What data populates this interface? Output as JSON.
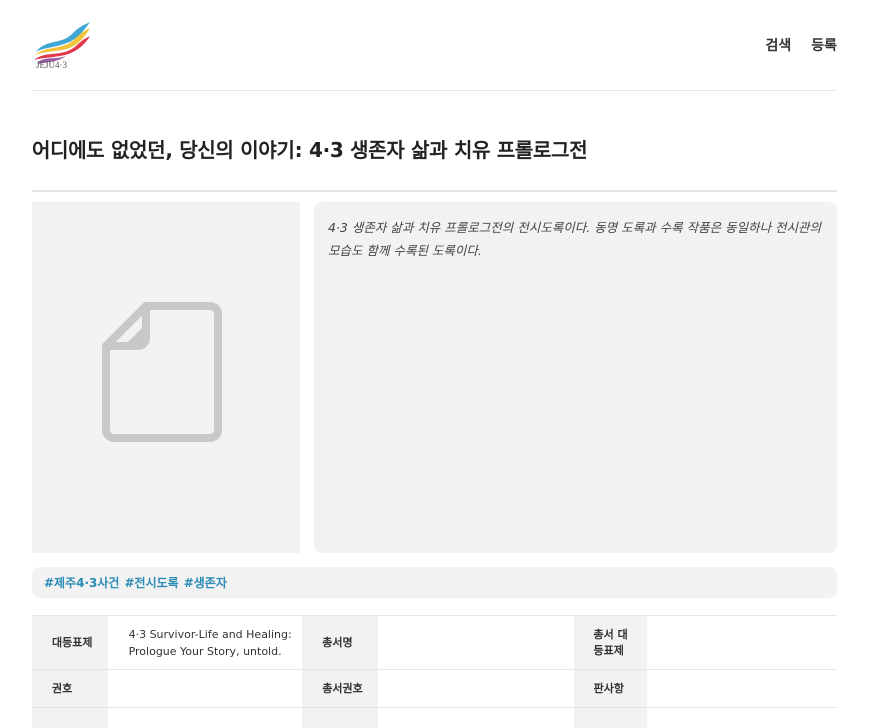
{
  "header": {
    "logo_text": "JEJU4·3",
    "nav": [
      "검색",
      "등록"
    ]
  },
  "page": {
    "title": "어디에도 없었던, 당신의 이야기: 4·3 생존자 삶과 치유 프롤로그전",
    "thumbnail_icon": "document-icon",
    "description": "4·3 생존자 삶과 치유 프롤로그전의 전시도록이다. 동명 도록과 수록 작품은 동일하나 전시관의 모습도 함께 수록된 도록이다.",
    "tags": [
      "#제주4·3사건",
      "#전시도록",
      "#생존자"
    ]
  },
  "metadata": {
    "rows": [
      [
        {
          "label": "대등표제",
          "value": "4·3 Survivor-Life and Healing: Prologue Your Story, untold."
        },
        {
          "label": "총서명",
          "value": ""
        },
        {
          "label": "총서 대등표제",
          "value": ""
        }
      ],
      [
        {
          "label": "권호",
          "value": ""
        },
        {
          "label": "총서권호",
          "value": ""
        },
        {
          "label": "판사항",
          "value": ""
        }
      ]
    ]
  },
  "colors": {
    "tag_link": "#2a8bb5",
    "panel_bg": "#f2f2f2",
    "logo_red": "#e0384b",
    "logo_yellow": "#f3c43a",
    "logo_blue": "#3fa7d6"
  }
}
